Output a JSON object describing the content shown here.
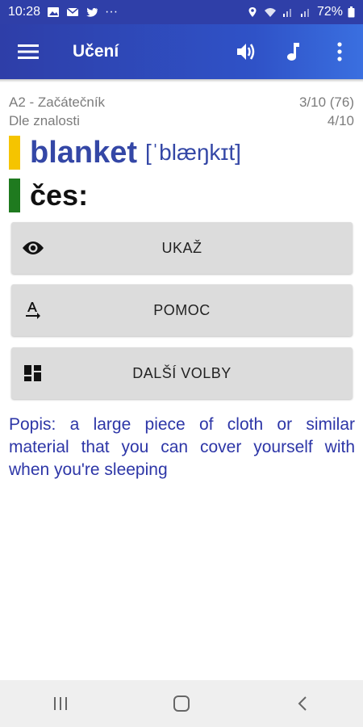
{
  "status_bar": {
    "time": "10:28",
    "more": "···",
    "battery": "72%"
  },
  "app_bar": {
    "title": "Učení",
    "icons": [
      "menu-icon",
      "volume-icon",
      "music-note-icon",
      "more-vert-icon"
    ]
  },
  "meta": {
    "level": "A2 - Začátečník",
    "progress_primary": "3/10 (76)",
    "mode": "Dle znalosti",
    "progress_secondary": "4/10"
  },
  "card": {
    "word": "blanket",
    "ipa": "[ˈblæŋkɪt]",
    "language_label": "čes:"
  },
  "buttons": {
    "show": "UKAŽ",
    "help": "POMOC",
    "more_options": "DALŠÍ VOLBY"
  },
  "description": "Popis: a large piece of cloth or similar material that you can cover yourself with when you're sleeping",
  "colors": {
    "app_bar": "#2f3fa8",
    "word": "#3447a6",
    "marker_yellow": "#f5c400",
    "marker_green": "#1f7a1f",
    "description": "#2d36a7"
  }
}
